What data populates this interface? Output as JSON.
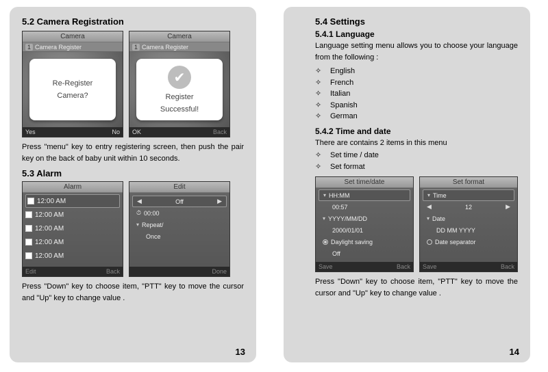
{
  "left": {
    "h52": "5.2 Camera Registration",
    "dev1": {
      "title": "Camera",
      "sub": "Camera Register",
      "dlg1": "Re-Register",
      "dlg2": "Camera?",
      "fl": "Yes",
      "fr": "No"
    },
    "dev2": {
      "title": "Camera",
      "sub": "Camera Register",
      "dlg1": "Register",
      "dlg2": "Successful!",
      "fl": "OK",
      "fr": "Back"
    },
    "para1": "Press \"menu\" key to entry registering screen, then push the pair key on the back of baby unit within 10 seconds.",
    "h53": "5.3 Alarm",
    "dev3": {
      "title": "Alarm",
      "items": [
        "12:00 AM",
        "12:00 AM",
        "12:00 AM",
        "12:00 AM",
        "12:00 AM"
      ],
      "fl": "Edit",
      "fr": "Back"
    },
    "dev4": {
      "title": "Edit",
      "off": "Off",
      "time": "00:00",
      "repeat_lbl": "Repeat/",
      "repeat_val": "Once",
      "fl": "",
      "fr": "Done"
    },
    "para2": "Press \"Down\" key to choose item, \"PTT\" key to move the cursor and \"Up\" key to change value .",
    "pagenum": "13"
  },
  "right": {
    "h54": "5.4 Settings",
    "h541": "5.4.1 Language",
    "lang_intro": "Language setting menu allows you to choose your language from the following :",
    "langs": [
      "English",
      "French",
      "Italian",
      "Spanish",
      "German"
    ],
    "h542": "5.4.2 Time and date",
    "td_intro": "There are contains 2 items in this menu",
    "td_items": [
      "Set time / date",
      "Set format"
    ],
    "dev5": {
      "title": "Set time/date",
      "rows": [
        {
          "lbl": "HH:MM",
          "val": ""
        },
        {
          "lbl": "00:57",
          "val": ""
        },
        {
          "lbl": "YYYY/MM/DD",
          "val": ""
        },
        {
          "lbl": "2000/01/01",
          "val": ""
        },
        {
          "lbl": "Daylight saving",
          "val": ""
        },
        {
          "lbl": "Off",
          "val": ""
        }
      ],
      "fl": "Save",
      "fr": "Back"
    },
    "dev6": {
      "title": "Set format",
      "rows": [
        {
          "lbl": "Time",
          "val": ""
        },
        {
          "lbl": "",
          "val": "12"
        },
        {
          "lbl": "Date",
          "val": ""
        },
        {
          "lbl": "DD MM YYYY",
          "val": ""
        },
        {
          "lbl": "Date separator",
          "val": ""
        }
      ],
      "fl": "Save",
      "fr": "Back"
    },
    "para3": "Press \"Down\" key to choose item, \"PTT\" key to move the cursor and \"Up\" key to change value .",
    "pagenum": "14"
  }
}
